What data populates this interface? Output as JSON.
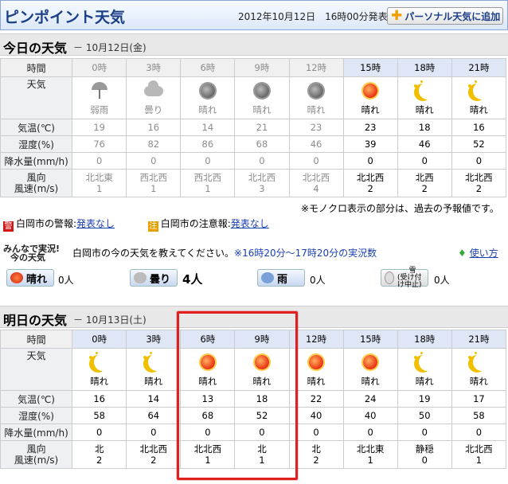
{
  "header": {
    "title": "ピンポイント天気",
    "issued": "2012年10月12日　16時00分発表",
    "personal_button": "パーソナル天気に追加"
  },
  "today": {
    "section_title": "今日の天気",
    "date": "－ 10月12日(金)",
    "labels": {
      "time": "時間",
      "weather": "天気",
      "temp": "気温(℃)",
      "humidity": "湿度(%)",
      "precip": "降水量(mm/h)",
      "wind_dir": "風向",
      "wind_speed": "風速(m/s)"
    },
    "hours": [
      {
        "time": "0時",
        "icon": "umbrella-icon",
        "weather": "弱雨",
        "temp": "19",
        "humidity": "76",
        "precip": "0",
        "wind_dir": "北北東",
        "wind_speed": "1",
        "past": true
      },
      {
        "time": "3時",
        "icon": "cloud-icon",
        "weather": "曇り",
        "temp": "16",
        "humidity": "82",
        "precip": "0",
        "wind_dir": "西北西",
        "wind_speed": "1",
        "past": true
      },
      {
        "time": "6時",
        "icon": "sun-icon",
        "weather": "晴れ",
        "temp": "14",
        "humidity": "86",
        "precip": "0",
        "wind_dir": "西北西",
        "wind_speed": "1",
        "past": true
      },
      {
        "time": "9時",
        "icon": "sun-icon",
        "weather": "晴れ",
        "temp": "21",
        "humidity": "68",
        "precip": "0",
        "wind_dir": "北北西",
        "wind_speed": "3",
        "past": true
      },
      {
        "time": "12時",
        "icon": "sun-icon",
        "weather": "晴れ",
        "temp": "23",
        "humidity": "46",
        "precip": "0",
        "wind_dir": "北北西",
        "wind_speed": "4",
        "past": true
      },
      {
        "time": "15時",
        "icon": "sun-icon",
        "weather": "晴れ",
        "temp": "23",
        "humidity": "39",
        "precip": "0",
        "wind_dir": "北北西",
        "wind_speed": "2",
        "past": false
      },
      {
        "time": "18時",
        "icon": "moon-icon",
        "weather": "晴れ",
        "temp": "18",
        "humidity": "46",
        "precip": "0",
        "wind_dir": "北西",
        "wind_speed": "2",
        "past": false
      },
      {
        "time": "21時",
        "icon": "moon-icon",
        "weather": "晴れ",
        "temp": "16",
        "humidity": "52",
        "precip": "0",
        "wind_dir": "北北西",
        "wind_speed": "2",
        "past": false
      }
    ],
    "note": "※モノクロ表示の部分は、過去の予報値です。"
  },
  "warnings": {
    "warning_tag": "警",
    "warning_label": "白岡市の警報:",
    "warning_link": "発表なし",
    "advisory_tag": "注",
    "advisory_label": "白岡市の注意報:",
    "advisory_link": "発表なし"
  },
  "minna": {
    "title_line1": "みんなで実況!",
    "title_line2": "今の天気",
    "info": "白岡市の今の天気を教えてください。",
    "info_period": "※16時20分～17時20分の実況数",
    "help": "使い方",
    "buttons": [
      {
        "label": "晴れ",
        "count": "0人"
      },
      {
        "label": "曇り",
        "count": "4人"
      },
      {
        "label": "雨",
        "count": "0人"
      },
      {
        "label": "雪",
        "sublabel": "(受け付け中止)",
        "count": "0人"
      }
    ]
  },
  "tomorrow": {
    "section_title": "明日の天気",
    "date": "－ 10月13日(土)",
    "hours": [
      {
        "time": "0時",
        "icon": "moon-icon",
        "weather": "晴れ",
        "temp": "16",
        "humidity": "58",
        "precip": "0",
        "wind_dir": "北",
        "wind_speed": "2"
      },
      {
        "time": "3時",
        "icon": "moon-icon",
        "weather": "晴れ",
        "temp": "14",
        "humidity": "64",
        "precip": "0",
        "wind_dir": "北北西",
        "wind_speed": "2"
      },
      {
        "time": "6時",
        "icon": "sun-icon",
        "weather": "晴れ",
        "temp": "13",
        "humidity": "68",
        "precip": "0",
        "wind_dir": "北北西",
        "wind_speed": "1"
      },
      {
        "time": "9時",
        "icon": "sun-icon",
        "weather": "晴れ",
        "temp": "18",
        "humidity": "52",
        "precip": "0",
        "wind_dir": "北",
        "wind_speed": "1"
      },
      {
        "time": "12時",
        "icon": "sun-icon",
        "weather": "晴れ",
        "temp": "22",
        "humidity": "40",
        "precip": "0",
        "wind_dir": "北",
        "wind_speed": "2"
      },
      {
        "time": "15時",
        "icon": "sun-icon",
        "weather": "晴れ",
        "temp": "24",
        "humidity": "40",
        "precip": "0",
        "wind_dir": "北北東",
        "wind_speed": "1"
      },
      {
        "time": "18時",
        "icon": "moon-icon",
        "weather": "晴れ",
        "temp": "19",
        "humidity": "50",
        "precip": "0",
        "wind_dir": "静穏",
        "wind_speed": "0"
      },
      {
        "time": "21時",
        "icon": "moon-icon",
        "weather": "晴れ",
        "temp": "17",
        "humidity": "58",
        "precip": "0",
        "wind_dir": "北北西",
        "wind_speed": "1"
      }
    ]
  }
}
